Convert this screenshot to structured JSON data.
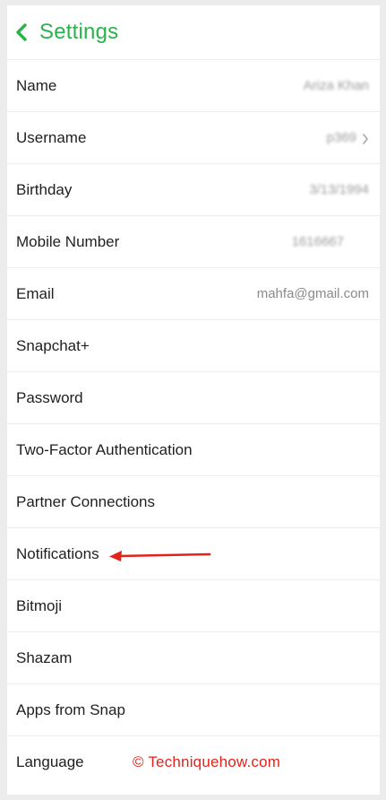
{
  "header": {
    "title": "Settings",
    "back_icon": "chevron-left-icon",
    "accent_color": "#28b44a"
  },
  "rows": [
    {
      "label": "Name",
      "value": "Ariza Khan"
    },
    {
      "label": "Username",
      "value": "p369"
    },
    {
      "label": "Birthday",
      "value": "3/13/1994"
    },
    {
      "label": "Mobile Number",
      "value": "1616667"
    },
    {
      "label": "Email",
      "value": "mahfa@gmail.com"
    },
    {
      "label": "Snapchat+"
    },
    {
      "label": "Password"
    },
    {
      "label": "Two-Factor Authentication"
    },
    {
      "label": "Partner Connections"
    },
    {
      "label": "Notifications"
    },
    {
      "label": "Bitmoji"
    },
    {
      "label": "Shazam"
    },
    {
      "label": "Apps from Snap"
    },
    {
      "label": "Language"
    }
  ],
  "watermark": "© Techniquehow.com",
  "annotation_color": "#e2231a"
}
